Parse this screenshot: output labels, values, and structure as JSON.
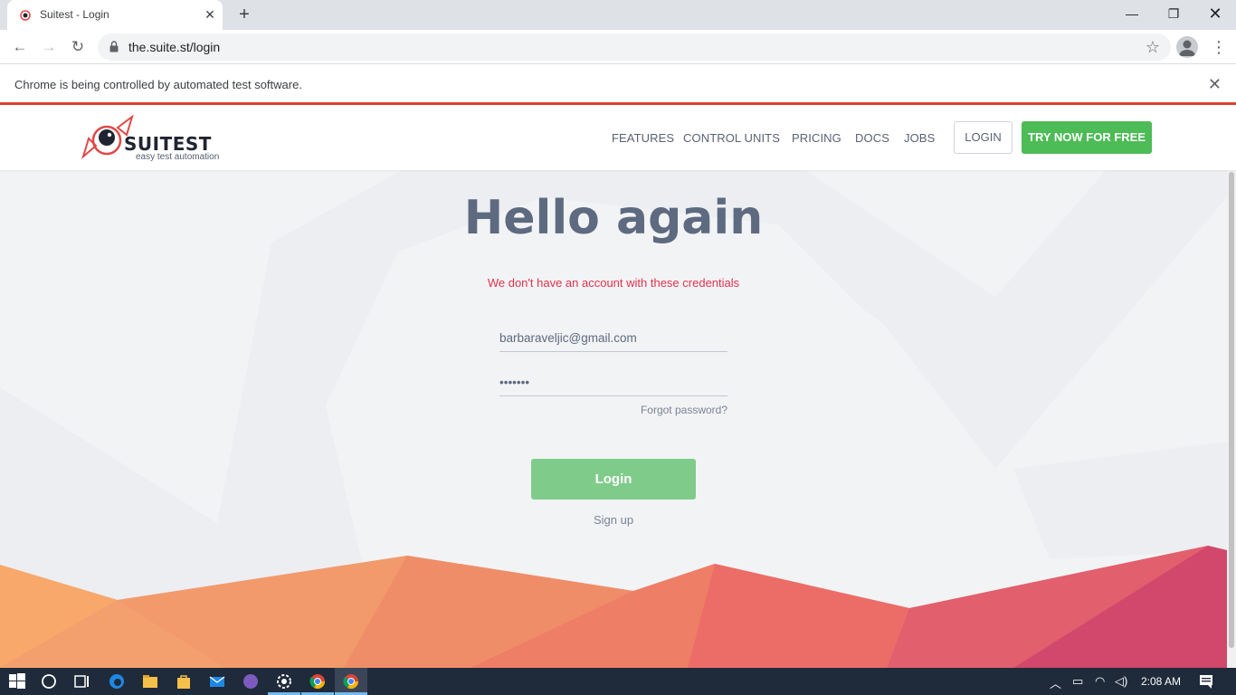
{
  "browser": {
    "tab_title": "Suitest - Login",
    "url": "the.suite.st/login",
    "infobar_message": "Chrome is being controlled by automated test software."
  },
  "site": {
    "brand": "SUITEST",
    "tagline": "easy test automation",
    "nav": [
      "FEATURES",
      "CONTROL UNITS",
      "PRICING",
      "DOCS",
      "JOBS"
    ],
    "login_label": "LOGIN",
    "cta_label": "TRY NOW FOR FREE",
    "accent_green": "#4dbb56",
    "error_red": "#e0334b"
  },
  "login_form": {
    "heading": "Hello again",
    "error": "We don't have an account with these credentials",
    "email_value": "barbaraveljic@gmail.com",
    "password_value": "•••••••",
    "forgot_label": "Forgot password?",
    "submit_label": "Login",
    "signup_label": "Sign up"
  },
  "taskbar": {
    "clock": "2:08 AM",
    "apps": [
      "start-icon",
      "search-icon",
      "task-view-icon",
      "edge-icon",
      "file-explorer-icon",
      "store-icon",
      "mail-icon",
      "viber-icon",
      "settings-icon",
      "chrome-icon",
      "chrome-active-icon"
    ]
  }
}
